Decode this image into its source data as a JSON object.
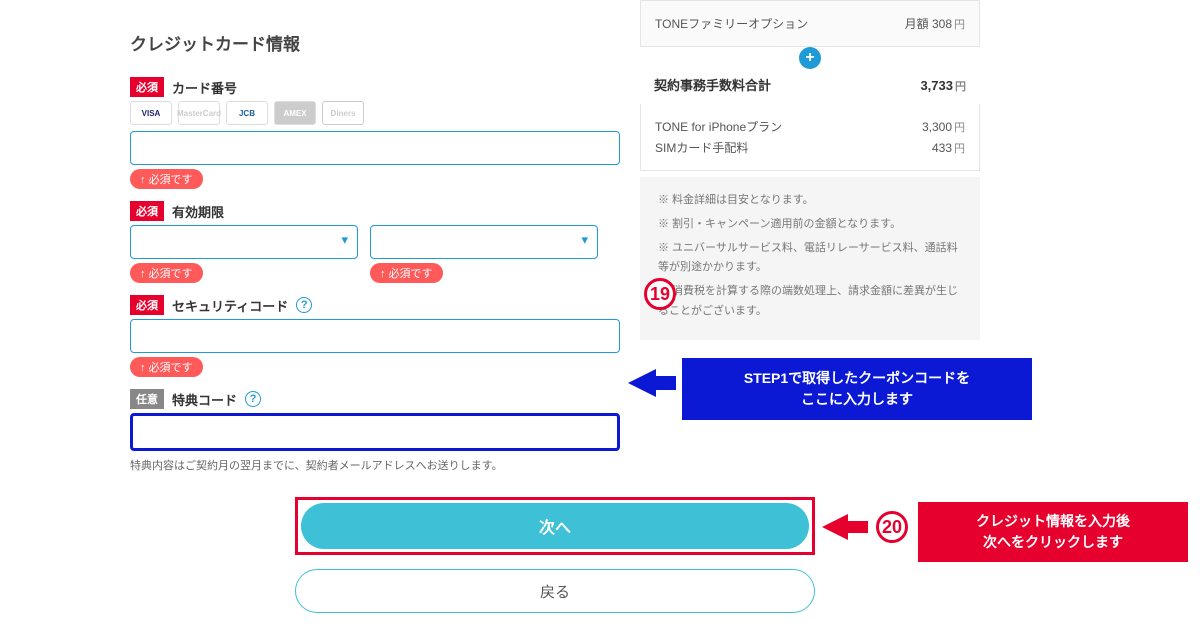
{
  "form": {
    "section_title": "クレジットカード情報",
    "required_badge": "必須",
    "optional_badge": "任意",
    "card_number": {
      "label": "カード番号",
      "error": "必須です"
    },
    "card_logos": [
      "VISA",
      "MasterCard",
      "JCB",
      "AMEX",
      "Diners"
    ],
    "expiry": {
      "label": "有効期限",
      "error_m": "必須です",
      "error_y": "必須です"
    },
    "security": {
      "label": "セキュリティコード",
      "error": "必須です"
    },
    "promo": {
      "label": "特典コード",
      "helper": "特典内容はご契約月の翌月までに、契約者メールアドレスへお送りします。"
    }
  },
  "summary": {
    "option_line": {
      "label": "TONEファミリーオプション",
      "prefix": "月額",
      "amount": "308",
      "unit": "円"
    },
    "total_line": {
      "label": "契約事務手数料合計",
      "amount": "3,733",
      "unit": "円"
    },
    "items": [
      {
        "label": "TONE for iPhoneプラン",
        "amount": "3,300",
        "unit": "円"
      },
      {
        "label": "SIMカード手配料",
        "amount": "433",
        "unit": "円"
      }
    ],
    "notes": [
      "※ 料金詳細は目安となります。",
      "※ 割引・キャンペーン適用前の金額となります。",
      "※ ユニバーサルサービス料、電話リレーサービス料、通話料等が別途かかります。",
      "※ 消費税を計算する際の端数処理上、請求金額に差異が生じることがございます。"
    ]
  },
  "annotations": {
    "step19": "19",
    "step20": "20",
    "callout_blue_l1": "STEP1で取得したクーポンコードを",
    "callout_blue_l2": "ここに入力します",
    "callout_red_l1": "クレジット情報を入力後",
    "callout_red_l2": "次へをクリックします"
  },
  "buttons": {
    "next": "次へ",
    "back": "戻る"
  }
}
